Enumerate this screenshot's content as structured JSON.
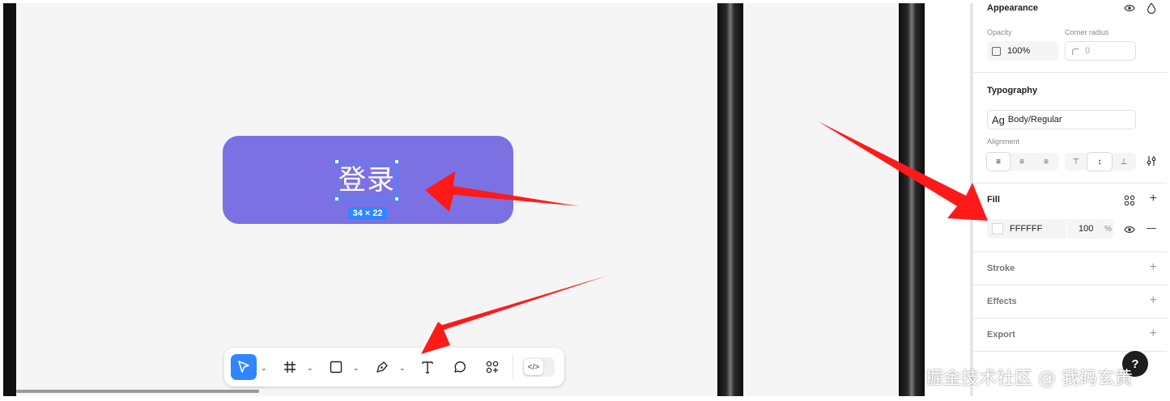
{
  "canvas": {
    "button_label": "登录",
    "button_color": "#7c71e3",
    "selection_size": "34 × 22",
    "selection_color": "#3d8bff"
  },
  "toolbar": {
    "tools": [
      {
        "name": "move",
        "icon": "cursor-arrow-icon",
        "active": true,
        "has_dropdown": true
      },
      {
        "name": "frame",
        "icon": "frame-hash-icon",
        "has_dropdown": true
      },
      {
        "name": "rectangle",
        "icon": "rectangle-icon",
        "has_dropdown": true
      },
      {
        "name": "pen",
        "icon": "pen-icon",
        "has_dropdown": true
      },
      {
        "name": "text",
        "icon": "text-T-icon",
        "has_dropdown": false
      },
      {
        "name": "comment",
        "icon": "comment-bubble-icon",
        "has_dropdown": false
      },
      {
        "name": "components",
        "icon": "components-grid-icon",
        "has_dropdown": false
      },
      {
        "name": "dev-mode",
        "icon": "code-brackets-icon",
        "has_dropdown": false
      }
    ],
    "accent": "#2f86ff"
  },
  "panel": {
    "appearance": {
      "title": "Appearance",
      "opacity_label": "Opacity",
      "opacity_value": "100%",
      "corner_radius_label": "Corner radius",
      "corner_radius_value": "0"
    },
    "typography": {
      "title": "Typography",
      "style_prefix": "Ag",
      "style_name": "Body/Regular",
      "alignment_label": "Alignment"
    },
    "fill": {
      "title": "Fill",
      "hex": "FFFFFF",
      "opacity": "100",
      "unit": "%"
    },
    "stroke": {
      "title": "Stroke"
    },
    "effects": {
      "title": "Effects"
    },
    "export": {
      "title": "Export"
    }
  },
  "help": {
    "label": "?"
  },
  "watermark": "掘金技术社区 @ 我码玄黄",
  "annotation_color": "#ff1a1a"
}
